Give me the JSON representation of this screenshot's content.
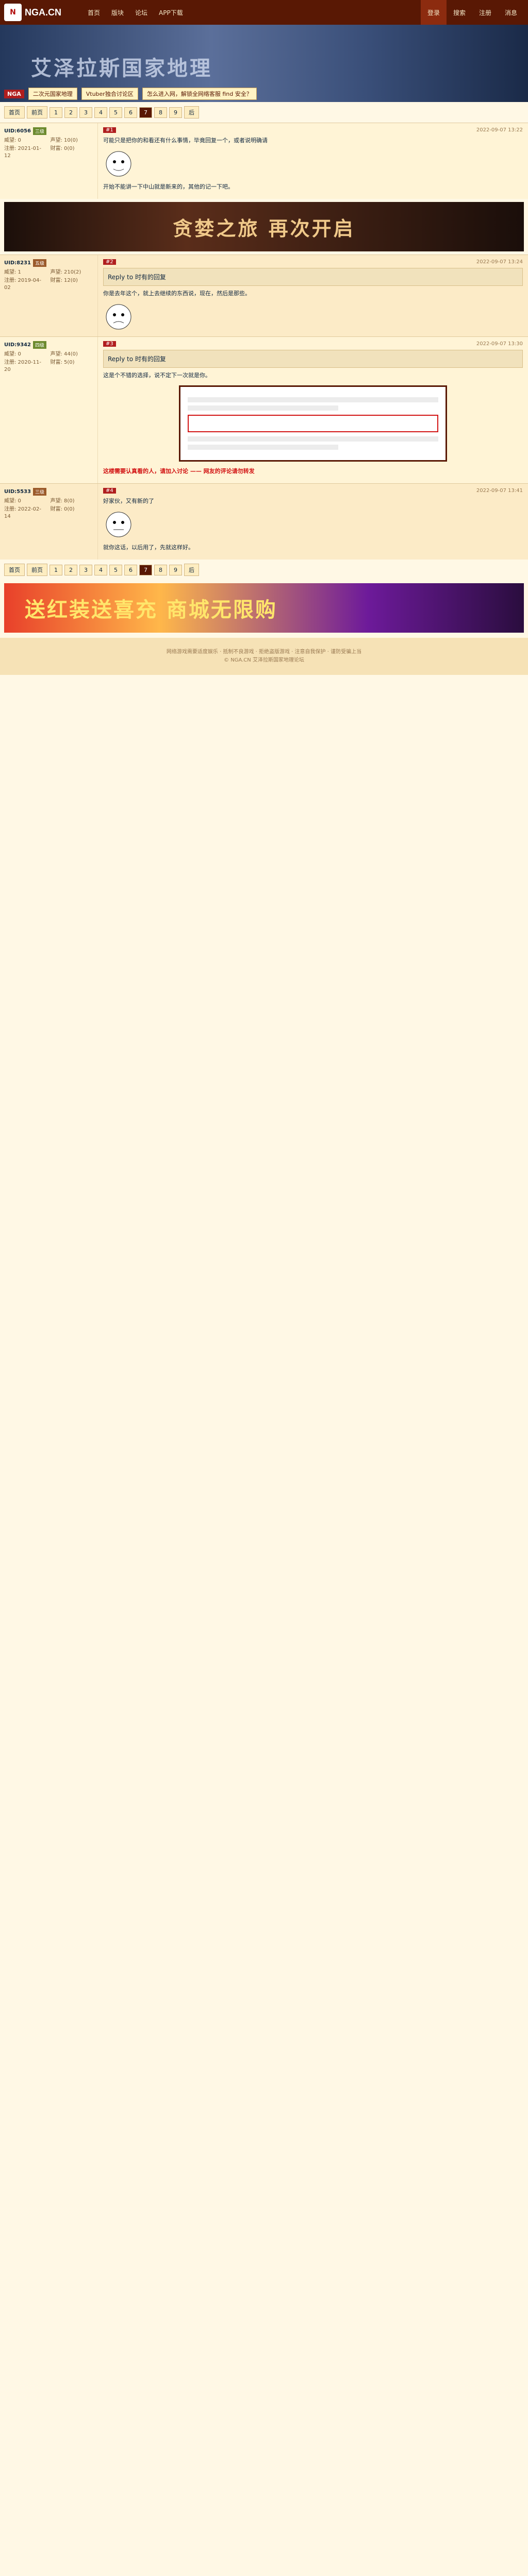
{
  "nav": {
    "logo_text": "NGA.CN",
    "links": [
      "首页",
      "版块",
      "论坛",
      "APP下载"
    ],
    "right": [
      "登录",
      "搜索",
      "注册",
      "消息"
    ]
  },
  "banner": {
    "title": "艾泽拉斯国家地理",
    "tag": "NGA",
    "chips": [
      "二次元国家地理",
      "Vtuber独合讨论区",
      "怎么进入网，解锁全网络客服 find 安全？"
    ]
  },
  "pager": {
    "labels": [
      "首页",
      "前页",
      "1",
      "2",
      "3",
      "4",
      "5",
      "6",
      "7",
      "8",
      "9",
      "后"
    ],
    "current": "7"
  },
  "ad1": {
    "text": "贪婪之旅 再次开启"
  },
  "ad2": {
    "text": "送红装送喜充 商城无限购"
  },
  "posts": [
    {
      "user": "UID:6056",
      "floor": "#1",
      "level": "三级",
      "time": "2022-09-07 13:22",
      "stats": [
        "威望: 0",
        "声望: 10(0)",
        "注册: 2021-01-12",
        "财富: 0(0)"
      ],
      "lines": [
        "可能只是把你的和看还有什么事情，毕竟回复一个，或者说明确请",
        "开始不能讲一下中山就是新来的，其他的记一下吧。"
      ]
    },
    {
      "user": "UID:8231",
      "floor": "#2",
      "level": "五级",
      "time": "2022-09-07 13:24",
      "stats": [
        "威望: 1",
        "声望: 210(2)",
        "注册: 2019-04-02",
        "财富: 12(0)"
      ],
      "lines": [
        "Reply to 时有的回复",
        "你是去年这个，就上去继续的东西说，现在，然后是那些。"
      ]
    },
    {
      "user": "UID:9342",
      "floor": "#3",
      "level": "四级",
      "time": "2022-09-07 13:30",
      "stats": [
        "威望: 0",
        "声望: 44(0)",
        "注册: 2020-11-20",
        "财富: 5(0)"
      ],
      "lines": [
        "Reply to 时有的回复",
        "这是个不错的选择，说不定下一次就是你。"
      ]
    },
    {
      "user": "UID:5533",
      "floor": "#4",
      "level": "三级",
      "time": "2022-09-07 13:41",
      "stats": [
        "威望: 0",
        "声望: 8(0)",
        "注册: 2022-02-14",
        "财富: 0(0)"
      ],
      "lines": [
        "好家伙，又有新的了",
        "就你这话，以后用了，先就这样好。"
      ]
    }
  ],
  "highlight": {
    "text": "这楼需要认真看的人，请加入讨论 —— 网友的评论请勿转发"
  },
  "footer": {
    "line1": "网络游戏需要适度娱乐 · 抵制不良游戏 · 拒绝盗版游戏 · 注意自我保护 · 谨防受骗上当",
    "line2": "© NGA.CN 艾泽拉斯国家地理论坛"
  }
}
